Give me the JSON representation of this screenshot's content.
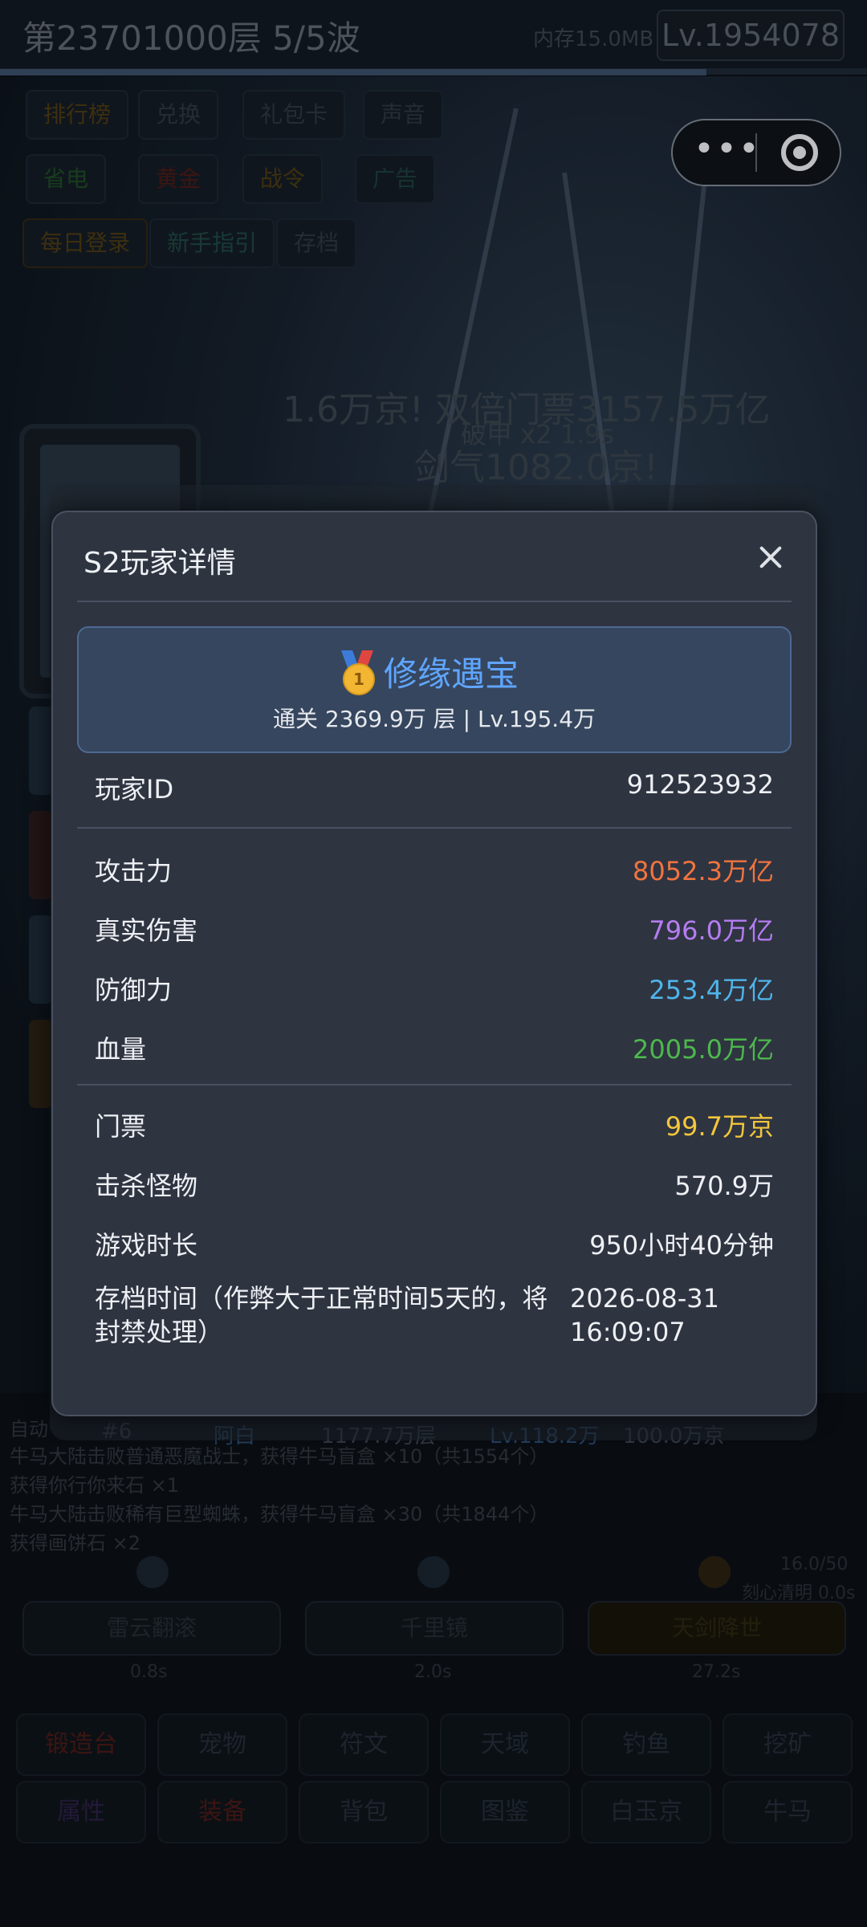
{
  "header": {
    "level_title": "第23701000层  5/5波",
    "memory": "内存15.0MB",
    "level_badge": "Lv.1954078"
  },
  "menu": {
    "row1": [
      "排行榜",
      "兑换",
      "礼包卡",
      "声音"
    ],
    "row2": [
      "省电",
      "黄金",
      "战令",
      "广告"
    ],
    "row3": [
      "每日登录",
      "新手指引",
      "存档"
    ]
  },
  "scene": {
    "line1": "1.6万京! 双倍门票3157.5万亿",
    "line2": "破甲 x2 1.9s",
    "line3": "剑气1082.0京!"
  },
  "rank_row": {
    "rank": "#6",
    "name": "阿白",
    "floors": "1177.7万层",
    "level": "Lv.118.2万",
    "extra": "100.0万京"
  },
  "log": {
    "prefix": "自动",
    "lines": [
      "牛马大陆击败普通恶魔战士，获得牛马盲盒 ×10（共1554个）",
      "获得你行你来石 ×1",
      "牛马大陆击败稀有巨型蜘蛛，获得牛马盲盒 ×30（共1844个）",
      "获得画饼石 ×2"
    ]
  },
  "skills": {
    "counter": "16.0/50",
    "status": "刻心清明 0.0s",
    "buttons": [
      "雷云翻滚",
      "千里镜",
      "天剑降世"
    ],
    "times": [
      "0.8s",
      "2.0s",
      "27.2s"
    ]
  },
  "nav": {
    "row1": [
      "锻造台",
      "宠物",
      "符文",
      "天域",
      "钓鱼",
      "挖矿"
    ],
    "row2": [
      "属性",
      "装备",
      "背包",
      "图鉴",
      "白玉京",
      "牛马"
    ]
  },
  "modal": {
    "title": "S2玩家详情",
    "badge_title": "修缘遇宝",
    "badge_medal_number": "1",
    "badge_sub": "通关 2369.9万 层 | Lv.195.4万",
    "player_id_label": "玩家ID",
    "player_id": "912523932",
    "stats": [
      {
        "label": "攻击力",
        "value": "8052.3万亿",
        "color": "#f0743f"
      },
      {
        "label": "真实伤害",
        "value": "796.0万亿",
        "color": "#b57cf2"
      },
      {
        "label": "防御力",
        "value": "253.4万亿",
        "color": "#4fb5ea"
      },
      {
        "label": "血量",
        "value": "2005.0万亿",
        "color": "#4cb94c"
      }
    ],
    "ticket_label": "门票",
    "ticket_value": "99.7万京",
    "ticket_color": "#f3c63c",
    "kills_label": "击杀怪物",
    "kills_value": "570.9万",
    "playtime_label": "游戏时长",
    "playtime_value": "950小时40分钟",
    "save_label": "存档时间（作弊大于正常时间5天的，将封禁处理）",
    "save_value": "2026-08-31 16:09:07"
  }
}
